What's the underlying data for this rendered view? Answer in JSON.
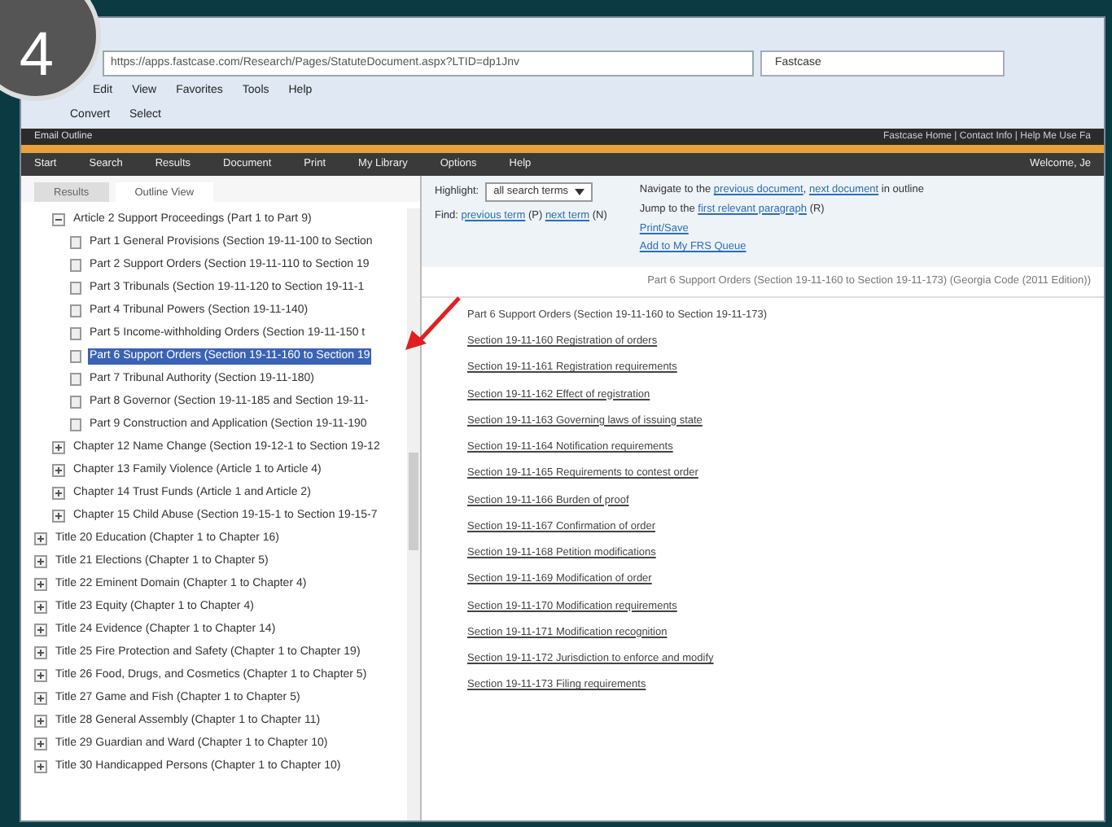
{
  "badge": "4",
  "browser": {
    "url": "https://apps.fastcase.com/Research/Pages/StatuteDocument.aspx?LTID=dp1Jnv",
    "tab": "Fastcase",
    "menu": [
      "Edit",
      "View",
      "Favorites",
      "Tools",
      "Help"
    ],
    "toolbar": [
      "Convert",
      "Select"
    ]
  },
  "site": {
    "top_left": "Email Outline",
    "top_right": "Fastcase Home | Contact Info | Help Me Use Fa",
    "nav": [
      "Start",
      "Search",
      "Results",
      "Document",
      "Print",
      "My Library",
      "Options",
      "Help"
    ],
    "welcome": "Welcome, Je"
  },
  "left_tabs": [
    {
      "label": "Results",
      "selected": false
    },
    {
      "label": "Outline View",
      "selected": true
    }
  ],
  "tree": [
    {
      "children": [
        {
          "label": "Article 2 Support Proceedings (Part 1 to Part 9)",
          "expanded": true,
          "children": [
            {
              "label": "Part 1 General Provisions (Section 19-11-100 to Section",
              "selected": false
            },
            {
              "label": "Part 2 Support Orders (Section 19-11-110 to Section 19",
              "selected": false
            },
            {
              "label": "Part 3 Tribunals (Section 19-11-120 to Section 19-11-1",
              "selected": false
            },
            {
              "label": "Part 4 Tribunal Powers (Section 19-11-140)",
              "selected": false
            },
            {
              "label": "Part 5 Income-withholding Orders (Section 19-11-150 t",
              "selected": false
            },
            {
              "label": "Part 6 Support Orders (Section 19-11-160 to Section 19",
              "selected": true
            },
            {
              "label": "Part 7 Tribunal Authority (Section 19-11-180)",
              "selected": false
            },
            {
              "label": "Part 8 Governor (Section 19-11-185 and Section 19-11-",
              "selected": false
            },
            {
              "label": "Part 9 Construction and Application (Section 19-11-190",
              "selected": false
            }
          ]
        },
        {
          "label": "Chapter 12 Name Change (Section 19-12-1 to Section 19-12",
          "expanded": false
        },
        {
          "label": "Chapter 13 Family Violence (Article 1 to Article 4)",
          "expanded": false
        },
        {
          "label": "Chapter 14 Trust Funds (Article 1 and Article 2)",
          "expanded": false
        },
        {
          "label": "Chapter 15 Child Abuse (Section 19-15-1 to Section 19-15-7",
          "expanded": false
        }
      ]
    },
    {
      "label": "Title 20 Education (Chapter 1 to Chapter 16)",
      "expanded": false
    },
    {
      "label": "Title 21 Elections (Chapter 1 to Chapter 5)",
      "expanded": false
    },
    {
      "label": "Title 22 Eminent Domain (Chapter 1 to Chapter 4)",
      "expanded": false
    },
    {
      "label": "Title 23 Equity (Chapter 1 to Chapter 4)",
      "expanded": false
    },
    {
      "label": "Title 24 Evidence (Chapter 1 to Chapter 14)",
      "expanded": false
    },
    {
      "label": "Title 25 Fire Protection and Safety (Chapter 1 to Chapter 19)",
      "expanded": false
    },
    {
      "label": "Title 26 Food, Drugs, and Cosmetics (Chapter 1 to Chapter 5)",
      "expanded": false
    },
    {
      "label": "Title 27 Game and Fish (Chapter 1 to Chapter 5)",
      "expanded": false
    },
    {
      "label": "Title 28 General Assembly (Chapter 1 to Chapter 11)",
      "expanded": false
    },
    {
      "label": "Title 29 Guardian and Ward (Chapter 1 to Chapter 10)",
      "expanded": false
    },
    {
      "label": "Title 30 Handicapped Persons (Chapter 1 to Chapter 10)",
      "expanded": false
    }
  ],
  "doc_toolbar": {
    "highlight_label": "Highlight:",
    "highlight_value": "all search terms",
    "find_label": "Find:",
    "find_prev": "previous term",
    "find_prev_key": "(P)",
    "find_next": "next term",
    "find_next_key": "(N)",
    "nav_text": "Navigate to the",
    "nav_prev": "previous document",
    "nav_sep": ",",
    "nav_next": "next document",
    "nav_rest": "in outline",
    "jump_text": "Jump to the",
    "jump_link": "first relevant paragraph",
    "jump_key": "(R)",
    "actions": [
      "Print/Save",
      "Add to My FRS Queue"
    ]
  },
  "doc": {
    "breadcrumb": "Part 6 Support Orders (Section 19-11-160 to Section 19-11-173) (Georgia Code (2011 Edition))",
    "heading": "Part 6 Support Orders (Section 19-11-160 to Section 19-11-173)",
    "sections": [
      "Section 19-11-160 Registration of orders",
      "Section 19-11-161 Registration requirements",
      "Section 19-11-162 Effect of registration",
      "Section 19-11-163 Governing laws of issuing state",
      "Section 19-11-164 Notification requirements",
      "Section 19-11-165 Requirements to contest order",
      "Section 19-11-166 Burden of proof",
      "Section 19-11-167 Confirmation of order",
      "Section 19-11-168 Petition modifications",
      "Section 19-11-169 Modification of order",
      "Section 19-11-170 Modification requirements",
      "Section 19-11-171 Modification recognition",
      "Section 19-11-172 Jurisdiction to enforce and modify",
      "Section 19-11-173 Filing requirements"
    ]
  }
}
